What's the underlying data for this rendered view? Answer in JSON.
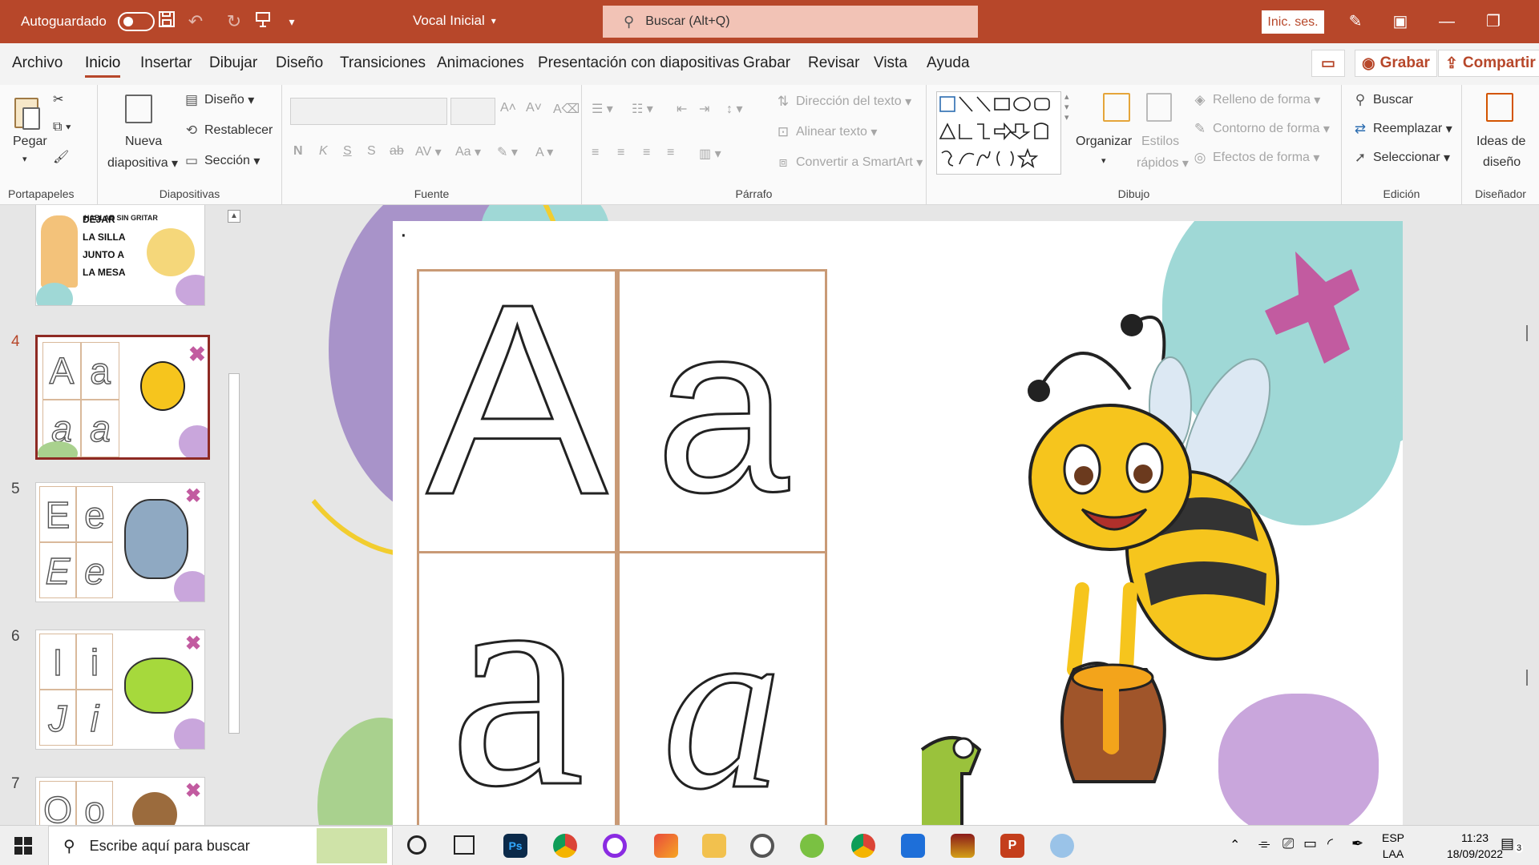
{
  "titlebar": {
    "autosave_label": "Autoguardado",
    "doc_title": "Vocal Inicial",
    "search_placeholder": "Buscar (Alt+Q)",
    "signin_label": "Inic. ses."
  },
  "tabs": {
    "items": [
      "Archivo",
      "Inicio",
      "Insertar",
      "Dibujar",
      "Diseño",
      "Transiciones",
      "Animaciones",
      "Presentación con diapositivas",
      "Grabar",
      "Revisar",
      "Vista",
      "Ayuda"
    ],
    "active": "Inicio",
    "record": "Grabar",
    "share": "Compartir"
  },
  "ribbon": {
    "clipboard": {
      "paste": "Pegar",
      "group": "Portapapeles"
    },
    "slides": {
      "new_slide_1": "Nueva",
      "new_slide_2": "diapositiva",
      "layout": "Diseño",
      "reset": "Restablecer",
      "section": "Sección",
      "group": "Diapositivas"
    },
    "font": {
      "bold": "N",
      "italic": "K",
      "underline": "S",
      "shadow": "S",
      "strike": "ab",
      "spacing": "AV",
      "case": "Aa",
      "group": "Fuente"
    },
    "paragraph": {
      "text_direction": "Dirección del texto",
      "align_text": "Alinear texto",
      "smartart": "Convertir a SmartArt",
      "group": "Párrafo"
    },
    "drawing": {
      "arrange": "Organizar",
      "quick_styles_1": "Estilos",
      "quick_styles_2": "rápidos",
      "shape_fill": "Relleno de forma",
      "shape_outline": "Contorno de forma",
      "shape_effects": "Efectos de forma",
      "group": "Dibujo"
    },
    "editing": {
      "find": "Buscar",
      "replace": "Reemplazar",
      "select": "Seleccionar",
      "group": "Edición"
    },
    "designer": {
      "ideas_1": "Ideas de",
      "ideas_2": "diseño",
      "group": "Diseñador"
    }
  },
  "thumbnails": {
    "slide3_text": [
      "DEJAR",
      "LA SILLA",
      "JUNTO A",
      "LA MESA"
    ],
    "slide3_banner": "HABLAR SIN GRITAR",
    "items": [
      {
        "number": "4",
        "letters": [
          "A",
          "a",
          "a",
          "a"
        ],
        "selected": true
      },
      {
        "number": "5",
        "letters": [
          "E",
          "e",
          "E",
          "e"
        ],
        "selected": false
      },
      {
        "number": "6",
        "letters": [
          "I",
          "i",
          "J",
          "i"
        ],
        "selected": false
      },
      {
        "number": "7",
        "letters": [
          "O",
          "o"
        ],
        "selected": false
      }
    ]
  },
  "slide": {
    "letters": [
      "A",
      "a",
      "a",
      "a"
    ]
  },
  "taskbar": {
    "search_placeholder": "Escribe aquí para buscar",
    "lang_1": "ESP",
    "lang_2": "LAA",
    "time": "11:23",
    "date": "18/09/2022",
    "notif_count": "3"
  },
  "colors": {
    "accent": "#b7472a",
    "slide_purple": "#a893c9",
    "slide_teal": "#9fd8d6",
    "slide_pink": "#c25ba0",
    "slide_green": "#a9d18e",
    "bee_yellow": "#f6c51d"
  }
}
